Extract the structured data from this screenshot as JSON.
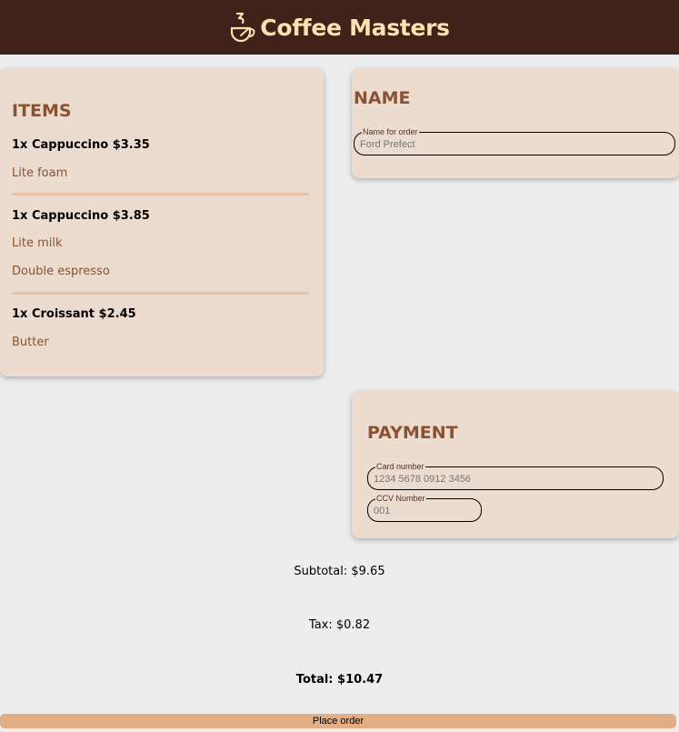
{
  "header": {
    "title": "Coffee Masters",
    "logo_icon": "coffee-cup-icon",
    "background": "#40221a",
    "title_color": "#f9e3b0"
  },
  "items_section": {
    "heading": "ITEMS",
    "items": [
      {
        "label": "1x Cappuccino $3.35",
        "options": [
          "Lite foam"
        ]
      },
      {
        "label": "1x Cappuccino $3.85",
        "options": [
          "Lite milk",
          "Double espresso"
        ]
      },
      {
        "label": "1x Croissant $2.45",
        "options": [
          "Butter"
        ]
      }
    ]
  },
  "name_section": {
    "heading": "NAME",
    "name_field": {
      "legend": "Name for order",
      "placeholder": "Ford Prefect"
    }
  },
  "payment_section": {
    "heading": "PAYMENT",
    "card_field": {
      "legend": "Card number",
      "placeholder": "1234 5678 0912 3456"
    },
    "ccv_field": {
      "legend": "CCV Number",
      "placeholder": "001"
    }
  },
  "summary": {
    "subtotal": "Subtotal: $9.65",
    "tax": "Tax: $0.82",
    "total": "Total: $10.47"
  },
  "actions": {
    "place_order": "Place order"
  },
  "colors": {
    "card_background": "#ecdcd0",
    "accent_brown": "#8a5230",
    "button": "#e2ae86",
    "page_background": "#ededed"
  }
}
